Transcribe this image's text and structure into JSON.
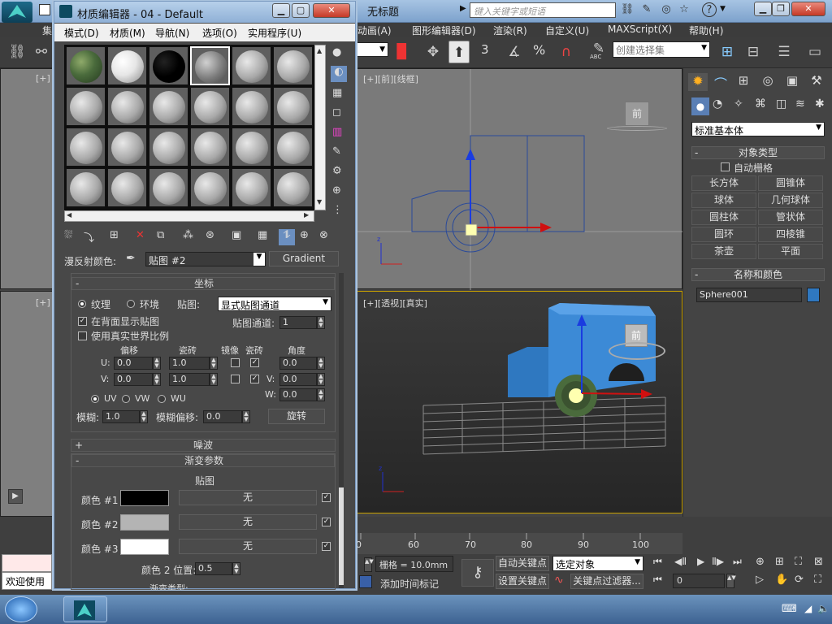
{
  "app": {
    "title": "无标题",
    "search_placeholder": "键入关键字或短语",
    "menu": [
      "动画(A)",
      "图形编辑器(D)",
      "渲染(R)",
      "自定义(U)",
      "MAXScript(X)",
      "帮助(H)"
    ],
    "toolbar": {
      "selection_set": "创建选择集",
      "num3": "3",
      "pct": "%",
      "abc": "ABC"
    },
    "left_menu_partial": "集"
  },
  "viewports": {
    "front": {
      "label": "[+][前][线框]",
      "cube": "前"
    },
    "perspective": {
      "label": "[+][透视][真实]",
      "cube": "前"
    },
    "left_labels": [
      "[+]",
      "[+]"
    ]
  },
  "command_panel": {
    "category": "标准基本体",
    "object_type_title": "对象类型",
    "auto_grid": "自动栅格",
    "buttons": [
      "长方体",
      "圆锥体",
      "球体",
      "几何球体",
      "圆柱体",
      "管状体",
      "圆环",
      "四棱锥",
      "茶壶",
      "平面"
    ],
    "name_color_title": "名称和颜色",
    "object_name": "Sphere001",
    "object_color": "#2f78c0"
  },
  "timeline": {
    "ticks": [
      "0",
      "60",
      "70",
      "80",
      "90",
      "100"
    ]
  },
  "bottom": {
    "grid": "栅格 = 10.0mm",
    "auto_key": "自动关键点",
    "set_key": "设置关键点",
    "key_mode": "选定对象",
    "key_filters": "关键点过滤器...",
    "add_time_tag": "添加时间标记",
    "frame": "0",
    "welcome": "欢迎使用"
  },
  "material_editor": {
    "title": "材质编辑器 - 04 - Default",
    "menu": [
      "模式(D)",
      "材质(M)",
      "导航(N)",
      "选项(O)",
      "实用程序(U)"
    ],
    "slot_colors": {
      "camo": "#4a6b3c",
      "white": "#f2f2f2",
      "black": "#000000",
      "gray": "#bdbdbd"
    },
    "diffuse_label": "漫反射颜色:",
    "map_name": "贴图 #2",
    "map_type": "Gradient",
    "coords": {
      "title": "坐标",
      "texture": "纹理",
      "environment": "环境",
      "mapping_label": "贴图:",
      "mapping": "显式贴图通道",
      "show_back": "在背面显示贴图",
      "map_channel_label": "贴图通道:",
      "map_channel": "1",
      "real_world": "使用真实世界比例",
      "offset": "偏移",
      "tiling": "瓷砖",
      "mirror": "镜像",
      "tile": "瓷砖",
      "angle": "角度",
      "u": "U:",
      "v": "V:",
      "w": "W:",
      "u_offset": "0.0",
      "v_offset": "0.0",
      "u_tiling": "1.0",
      "v_tiling": "1.0",
      "u_angle": "0.0",
      "v_angle": "0.0",
      "w_angle": "0.0",
      "uv": "UV",
      "vw": "VW",
      "wu": "WU",
      "blur_label": "模糊:",
      "blur": "1.0",
      "blur_offset_label": "模糊偏移:",
      "blur_offset": "0.0",
      "rotate": "旋转"
    },
    "noise_title": "噪波",
    "gradient": {
      "title": "渐变参数",
      "maps_label": "贴图",
      "color1": "颜色 #1",
      "color2": "颜色 #2",
      "color3": "颜色 #3",
      "swatch1": "#000000",
      "swatch2": "#b4b4b4",
      "swatch3": "#ffffff",
      "none": "无",
      "pos_label": "颜色 2 位置:",
      "pos": "0.5",
      "type_partial": "渐变类型:"
    }
  }
}
